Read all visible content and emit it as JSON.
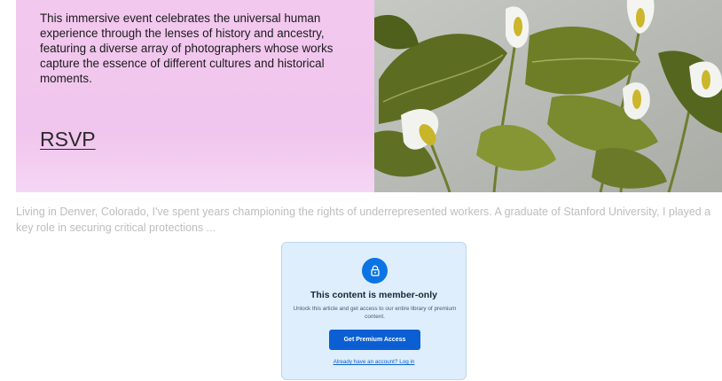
{
  "hero": {
    "description": "This immersive event celebrates the universal human experience through the lenses of history and ancestry, featuring a diverse array of photographers whose works capture the essence of different cultures and historical moments.",
    "rsvp_label": "RSVP",
    "image_icon": "calla-lily-photo"
  },
  "article": {
    "teaser": "Living in Denver, Colorado, I've spent years championing the rights of underrepresented workers. A graduate of Stanford University, I played a key role in securing critical protections ..."
  },
  "paywall": {
    "icon": "lock-icon",
    "title": "This content is member-only",
    "text": "Unlock this article and get access to our entire library of premium content.",
    "button_label": "Get Premium Access",
    "login_link": "Already have an account? Log in"
  },
  "colors": {
    "hero_bg": "#f2c8ef",
    "accent": "#0b74e5",
    "button": "#0b5fd3",
    "paywall_bg": "#deeefc"
  }
}
